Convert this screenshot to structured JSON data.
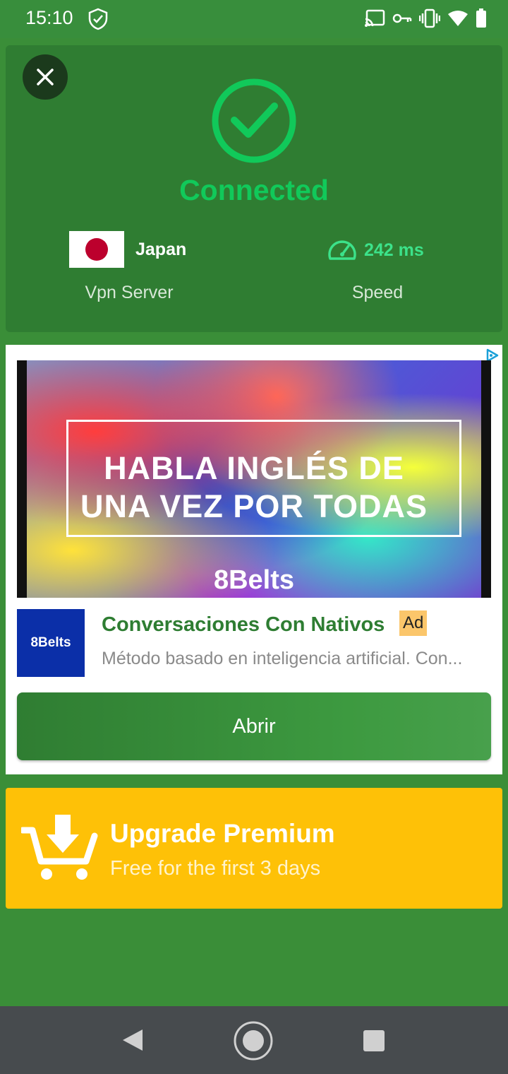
{
  "status_bar": {
    "time": "15:10"
  },
  "vpn": {
    "status": "Connected",
    "country": "Japan",
    "server_label": "Vpn Server",
    "speed_value": "242 ms",
    "speed_label": "Speed"
  },
  "ad": {
    "banner_headline_line1": "HABLA INGLÉS DE",
    "banner_headline_line2": "UNA VEZ POR TODAS",
    "banner_brand": "8Belts",
    "logo_text": "8Belts",
    "title": "Conversaciones Con Nativos",
    "badge": "Ad",
    "description": "Método basado en inteligencia artificial. Con...",
    "cta_label": "Abrir"
  },
  "premium": {
    "title": "Upgrade Premium",
    "subtitle": "Free for the first 3 days"
  },
  "colors": {
    "background": "#3a8e38",
    "card": "#2f7d32",
    "connected_green": "#11c95a",
    "premium_yellow": "#fec107",
    "nav_bar": "#474b4e"
  }
}
